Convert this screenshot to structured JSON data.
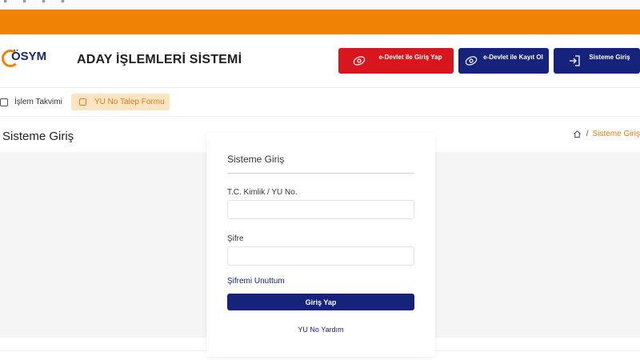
{
  "brand": {
    "logo_text": "ÖSYM",
    "system_title": "ADAY İŞLEMLERİ SİSTEMİ",
    "colors": {
      "orange": "#f08205",
      "navy": "#15237a",
      "red": "#d7161e"
    }
  },
  "header_buttons": {
    "edevlet_login": "e-Devlet ile Giriş Yap",
    "edevlet_register": "e-Devlet ile Kayıt Ol",
    "system_login": "Sisteme Giriş"
  },
  "subnav": {
    "calendar": "İşlem Takvimi",
    "yu_request": "YU No Talep Formu"
  },
  "page": {
    "title": "Sisteme Giriş",
    "breadcrumb_current": "Sisteme Giriş"
  },
  "login_form": {
    "title": "Sisteme Giriş",
    "tc_label": "T.C. Kimlik / YU No.",
    "tc_value": "",
    "password_label": "Şifre",
    "password_value": "",
    "forgot_password": "Şifremi Unuttum",
    "submit": "Giriş Yap",
    "help": "YU No Yardım"
  },
  "icons": [
    "home-icon",
    "calendar-icon",
    "form-icon",
    "edevlet-icon",
    "login-icon"
  ]
}
